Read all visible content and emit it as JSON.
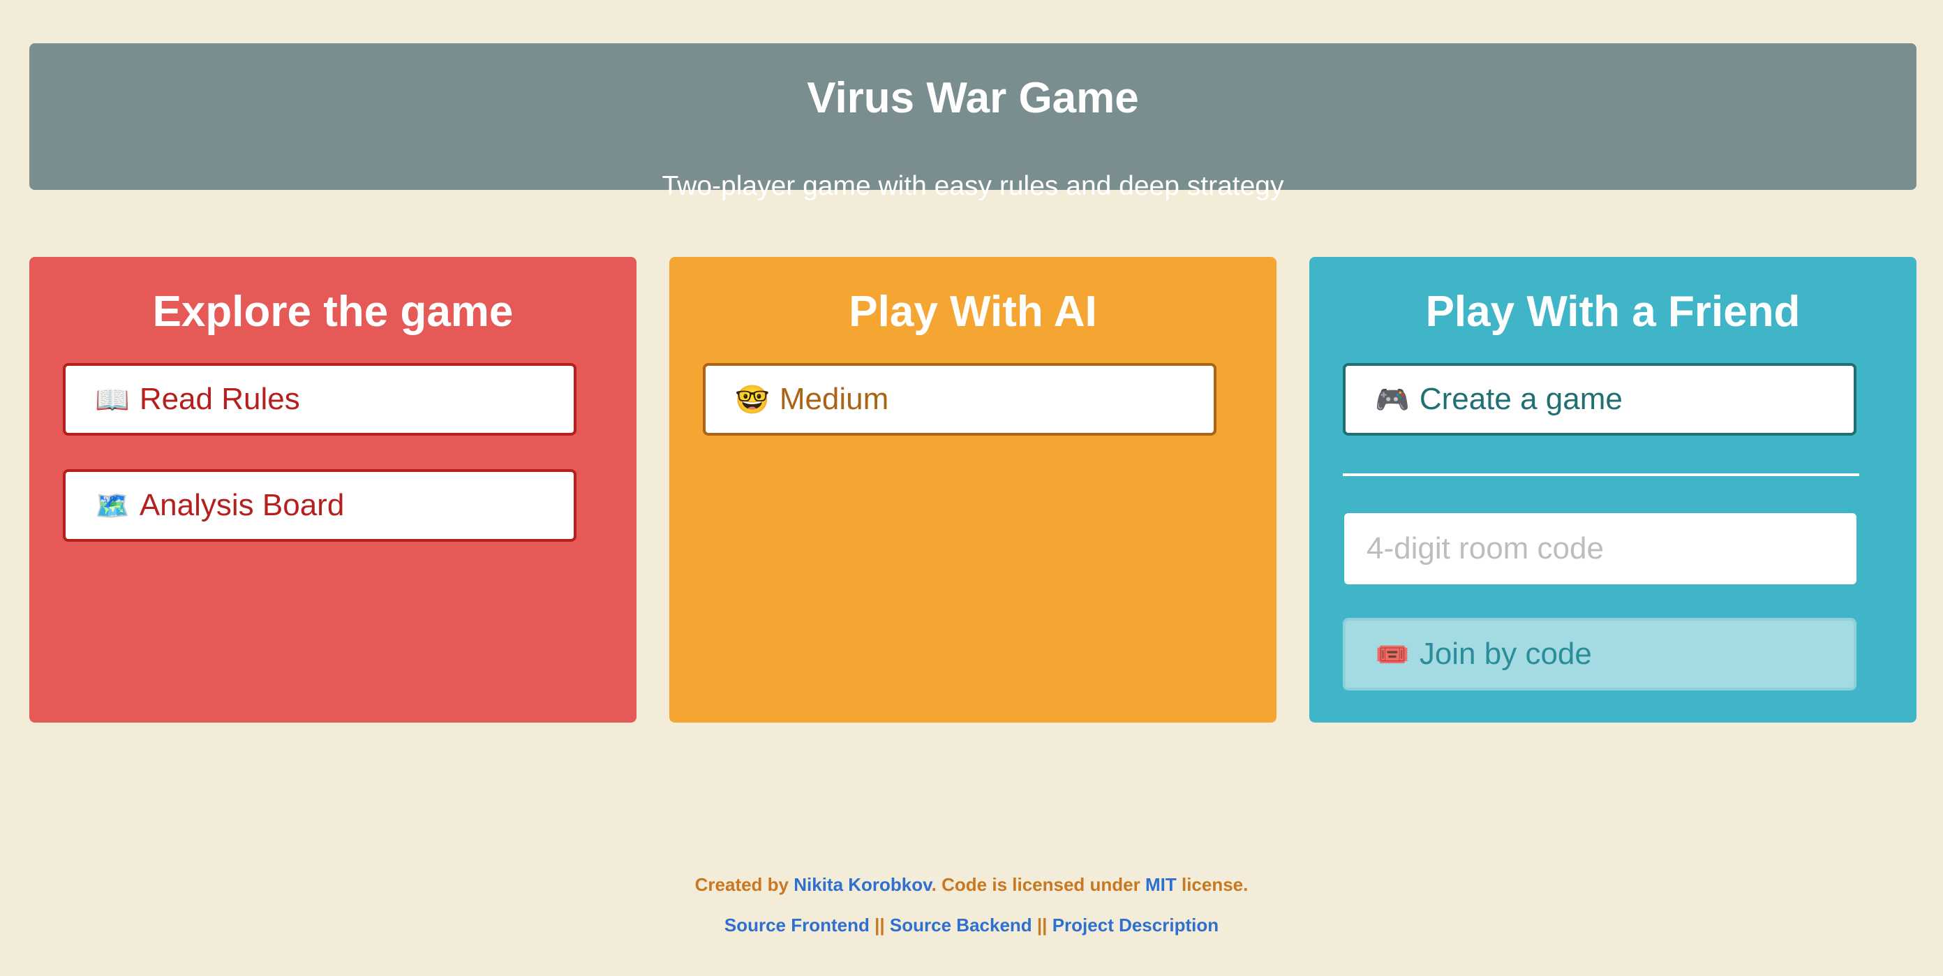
{
  "header": {
    "title": "Virus War Game",
    "subtitle": "Two-player game with easy rules and deep strategy"
  },
  "explore": {
    "title": "Explore the game",
    "read_rules": {
      "icon": "📖",
      "label": "Read Rules"
    },
    "analysis_board": {
      "icon": "🗺️",
      "label": "Analysis Board"
    }
  },
  "ai": {
    "title": "Play With AI",
    "medium": {
      "icon": "🤓",
      "label": "Medium"
    }
  },
  "friend": {
    "title": "Play With a Friend",
    "create": {
      "icon": "🎮",
      "label": "Create a game"
    },
    "code_placeholder": "4-digit room code",
    "join": {
      "icon": "🎟️",
      "label": "Join by code"
    }
  },
  "footer": {
    "created_by_prefix": "Created by ",
    "author": "Nikita Korobkov",
    "license_prefix": ". Code is licensed under ",
    "license": "MIT",
    "license_suffix": " license.",
    "links": [
      "Source Frontend",
      "Source Backend",
      "Project Description"
    ],
    "separator": "||"
  },
  "colors": {
    "background": "#f2ecd9",
    "header": "#7a8d8f",
    "explore": "#e55957",
    "ai": "#f5a532",
    "friend": "#3fb5c7",
    "link": "#2f6fd0",
    "footer_text": "#c87820"
  }
}
